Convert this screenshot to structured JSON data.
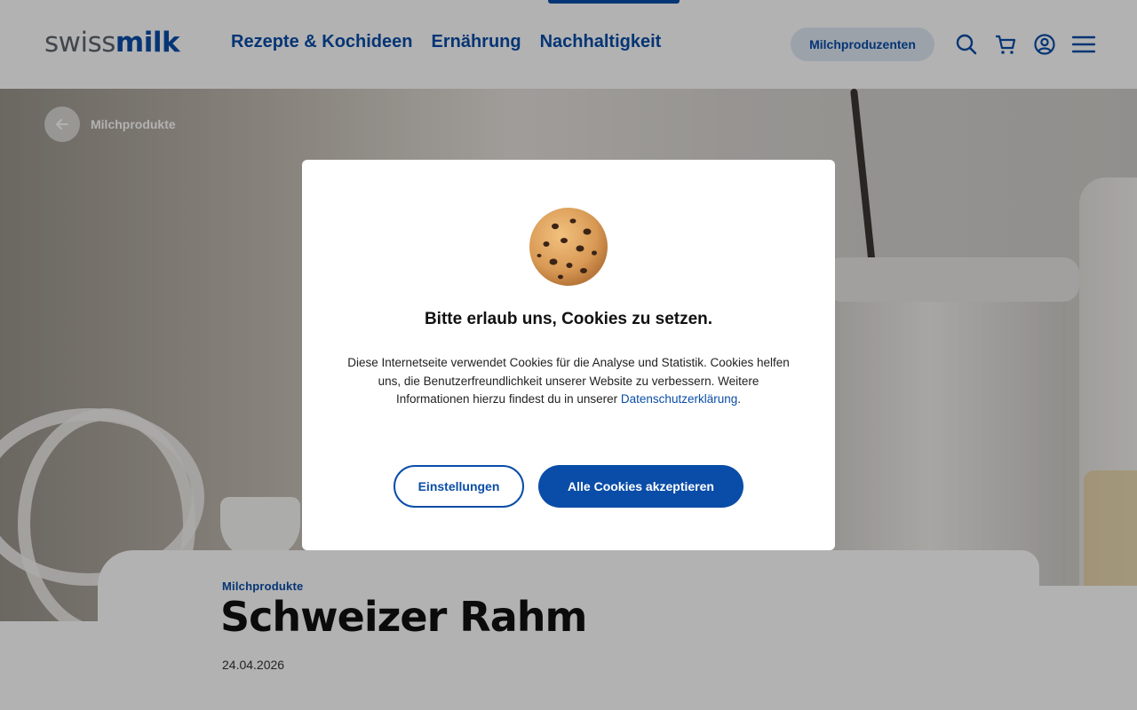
{
  "header": {
    "logo_left": "swiss",
    "logo_right": "milk",
    "nav": [
      {
        "label": "Rezepte & Kochideen"
      },
      {
        "label": "Ernährung"
      },
      {
        "label": "Nachhaltigkeit"
      }
    ],
    "producer_button": "Milchproduzenten"
  },
  "breadcrumb": {
    "back_label": "Milchprodukte"
  },
  "article": {
    "category": "Milchprodukte",
    "title": "Schweizer Rahm",
    "date": "24.04.2026"
  },
  "cookie_dialog": {
    "title": "Bitte erlaub uns, Cookies zu setzen.",
    "text_before_link": "Diese Internetseite verwendet Cookies für die Analyse und Statistik. Cookies helfen uns, die Benutzerfreundlichkeit unserer Website zu verbessern. Weitere Informationen hierzu findest du in unserer ",
    "link_text": "Datenschutzerklärung",
    "text_after_link": ".",
    "settings_button": "Einstellungen",
    "accept_button": "Alle Cookies akzeptieren"
  },
  "colors": {
    "brand_blue": "#0a4da8",
    "logo_gray": "#5d6670"
  }
}
